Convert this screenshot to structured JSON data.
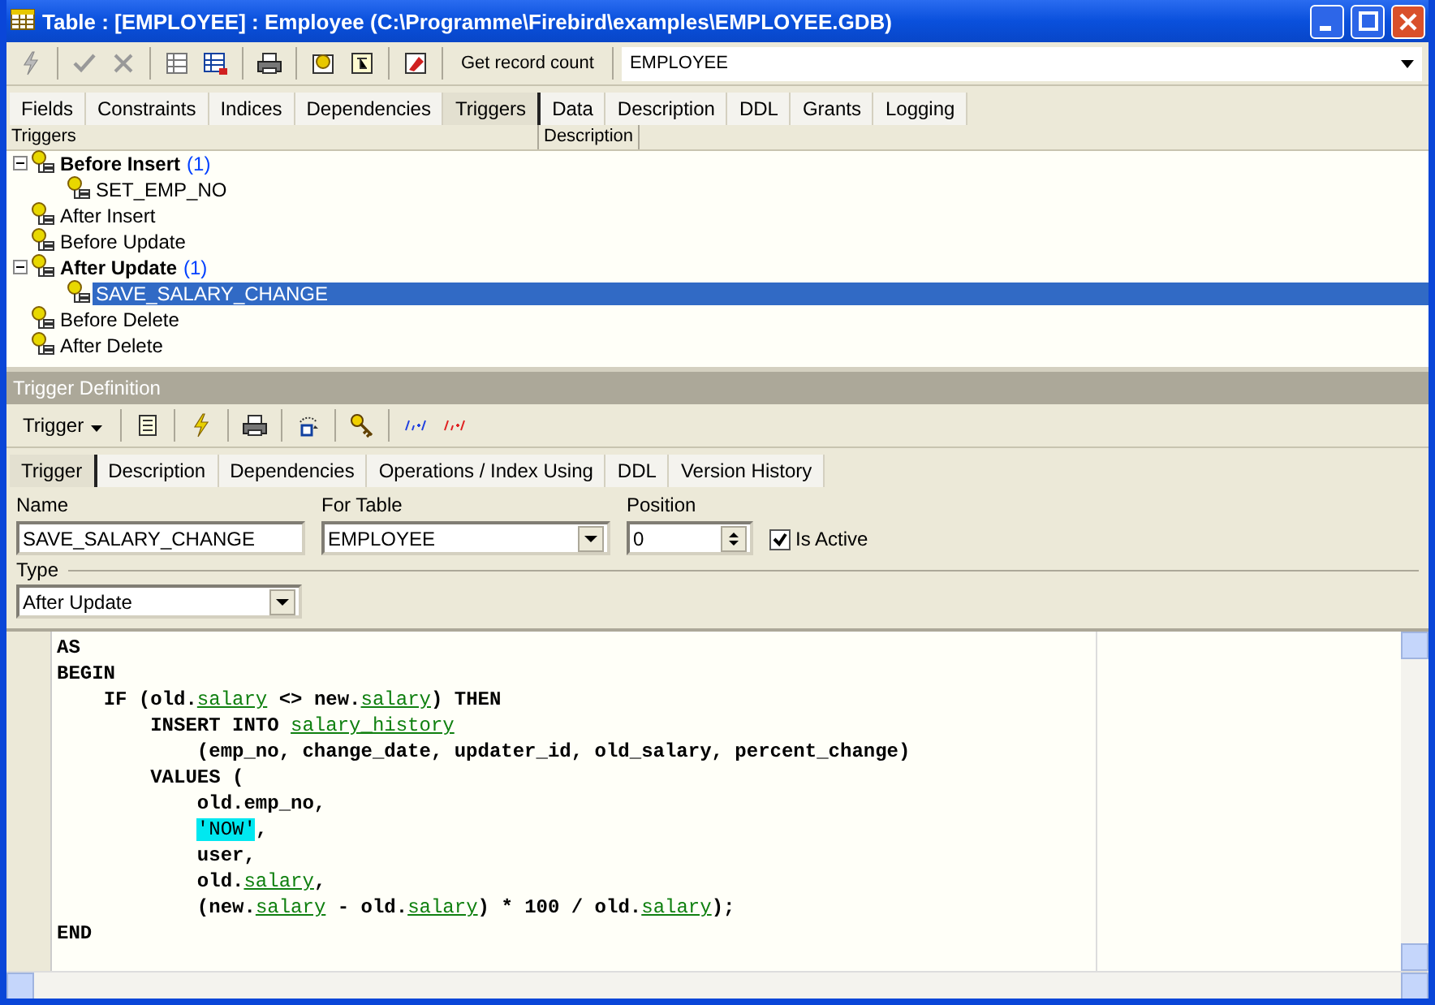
{
  "window": {
    "title": "Table : [EMPLOYEE] : Employee (C:\\Programme\\Firebird\\examples\\EMPLOYEE.GDB)"
  },
  "toolbar": {
    "get_record_count": "Get record count",
    "table_combo": "EMPLOYEE"
  },
  "tabs": [
    {
      "label": "Fields",
      "selected": false
    },
    {
      "label": "Constraints",
      "selected": false
    },
    {
      "label": "Indices",
      "selected": false
    },
    {
      "label": "Dependencies",
      "selected": false
    },
    {
      "label": "Triggers",
      "selected": true
    },
    {
      "label": "Data",
      "selected": false
    },
    {
      "label": "Description",
      "selected": false
    },
    {
      "label": "DDL",
      "selected": false
    },
    {
      "label": "Grants",
      "selected": false
    },
    {
      "label": "Logging",
      "selected": false
    }
  ],
  "trigger_tree": {
    "columns": [
      "Triggers",
      "Description"
    ],
    "nodes": [
      {
        "label": "Before Insert",
        "count": "(1)",
        "expanded": true,
        "selected": false,
        "children": [
          {
            "label": "SET_EMP_NO",
            "selected": false
          }
        ]
      },
      {
        "label": "After Insert",
        "selected": false
      },
      {
        "label": "Before Update",
        "selected": false
      },
      {
        "label": "After Update",
        "count": "(1)",
        "expanded": true,
        "selected": false,
        "children": [
          {
            "label": "SAVE_SALARY_CHANGE",
            "selected": true
          }
        ]
      },
      {
        "label": "Before Delete",
        "selected": false
      },
      {
        "label": "After Delete",
        "selected": false
      }
    ]
  },
  "trigger_definition": {
    "title": "Trigger Definition",
    "menu_button": "Trigger",
    "tabs": [
      {
        "label": "Trigger",
        "selected": true
      },
      {
        "label": "Description",
        "selected": false
      },
      {
        "label": "Dependencies",
        "selected": false
      },
      {
        "label": "Operations / Index Using",
        "selected": false
      },
      {
        "label": "DDL",
        "selected": false
      },
      {
        "label": "Version History",
        "selected": false
      }
    ],
    "name": {
      "label": "Name",
      "value": "SAVE_SALARY_CHANGE"
    },
    "for_table": {
      "label": "For Table",
      "value": "EMPLOYEE"
    },
    "position": {
      "label": "Position",
      "value": "0"
    },
    "is_active": {
      "label": "Is Active",
      "checked": true
    },
    "type": {
      "label": "Type",
      "value": "After Update"
    },
    "code": [
      [
        {
          "t": "AS",
          "kind": "kw"
        }
      ],
      [
        {
          "t": "BEGIN",
          "kind": "kw"
        }
      ],
      [
        {
          "t": "    IF (old.",
          "kind": "kw"
        },
        {
          "t": "salary",
          "kind": "ident"
        },
        {
          "t": " <> new.",
          "kind": "kw"
        },
        {
          "t": "salary",
          "kind": "ident"
        },
        {
          "t": ") THEN",
          "kind": "kw"
        }
      ],
      [
        {
          "t": "        INSERT INTO ",
          "kind": "kw"
        },
        {
          "t": "salary_history",
          "kind": "ident"
        }
      ],
      [
        {
          "t": "            (emp_no, change_date, updater_id, old_salary, percent_change)",
          "kind": "text"
        }
      ],
      [
        {
          "t": "        VALUES (",
          "kind": "kw"
        }
      ],
      [
        {
          "t": "            old.emp_no,",
          "kind": "kw"
        }
      ],
      [
        {
          "t": "            'NOW'",
          "kind": "string"
        },
        {
          "t": ",",
          "kind": "kw"
        }
      ],
      [
        {
          "t": "            user,",
          "kind": "kw"
        }
      ],
      [
        {
          "t": "            old.",
          "kind": "kw"
        },
        {
          "t": "salary",
          "kind": "ident"
        },
        {
          "t": ",",
          "kind": "kw"
        }
      ],
      [
        {
          "t": "            (new.",
          "kind": "kw"
        },
        {
          "t": "salary",
          "kind": "ident"
        },
        {
          "t": " - old.",
          "kind": "kw"
        },
        {
          "t": "salary",
          "kind": "ident"
        },
        {
          "t": ") * 100 / old.",
          "kind": "kw"
        },
        {
          "t": "salary",
          "kind": "ident"
        },
        {
          "t": ");",
          "kind": "kw"
        }
      ],
      [
        {
          "t": "END",
          "kind": "kw"
        }
      ]
    ]
  }
}
